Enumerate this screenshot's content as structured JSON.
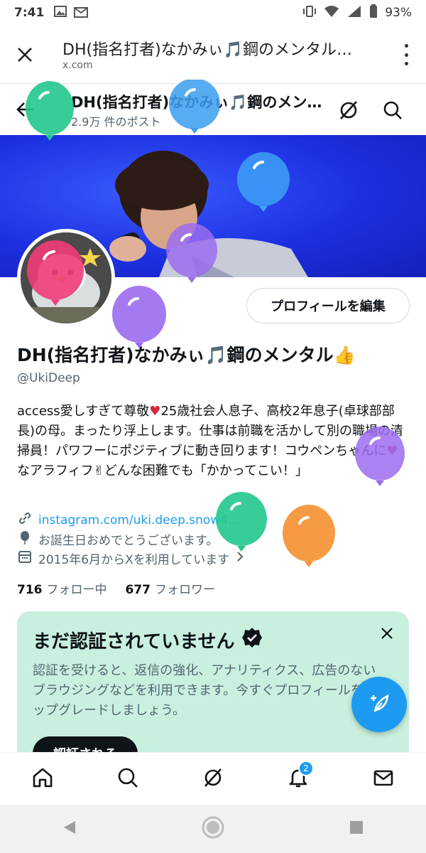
{
  "status_bar": {
    "time": "7:41",
    "battery": "93%"
  },
  "browser": {
    "title": "DH(指名打者)なかみぃ🎵鋼のメンタル…",
    "domain": "x.com"
  },
  "header": {
    "name": "DH(指名打者)なかみぃ🎵鋼のメンタル",
    "post_count": "2.9万 件のポスト"
  },
  "profile": {
    "edit_button": "プロフィールを編集",
    "display_name": "DH(指名打者)なかみぃ🎵鋼のメンタル👍",
    "handle": "@UkiDeep",
    "bio_1": "access愛しすぎて尊敬",
    "bio_heart_1": "♥",
    "bio_2": "25歳社会人息子、高校2年息子(卓球部部長)の母。まったり浮上します。仕事は前職を活かして別の職場の清掃員！パワフーにポジティブに動き回ります！コウペンちゃんに",
    "bio_heart_2": "♥",
    "bio_3": "なアラフィフ✌どんな困難でも「かかってこい！」",
    "link": "instagram.com/uki.deep.snow4…",
    "birthday": "お誕生日おめでとうございます。",
    "joined": "2015年6月からXを利用しています",
    "following_count": "716",
    "following_label": "フォロー中",
    "followers_count": "677",
    "followers_label": "フォロワー"
  },
  "verify_card": {
    "title": "まだ認証されていません",
    "body": "認証を受けると、返信の強化、アナリティクス、広告のないブラウジングなどを利用できます。今すぐプロフィールをアップグレードしましょう。",
    "button": "認証される"
  },
  "bottom_nav": {
    "notification_badge": "2"
  },
  "colors": {
    "accent": "#1d9bf0",
    "card": "#c9f0df",
    "banner": "#1c2fe0"
  }
}
